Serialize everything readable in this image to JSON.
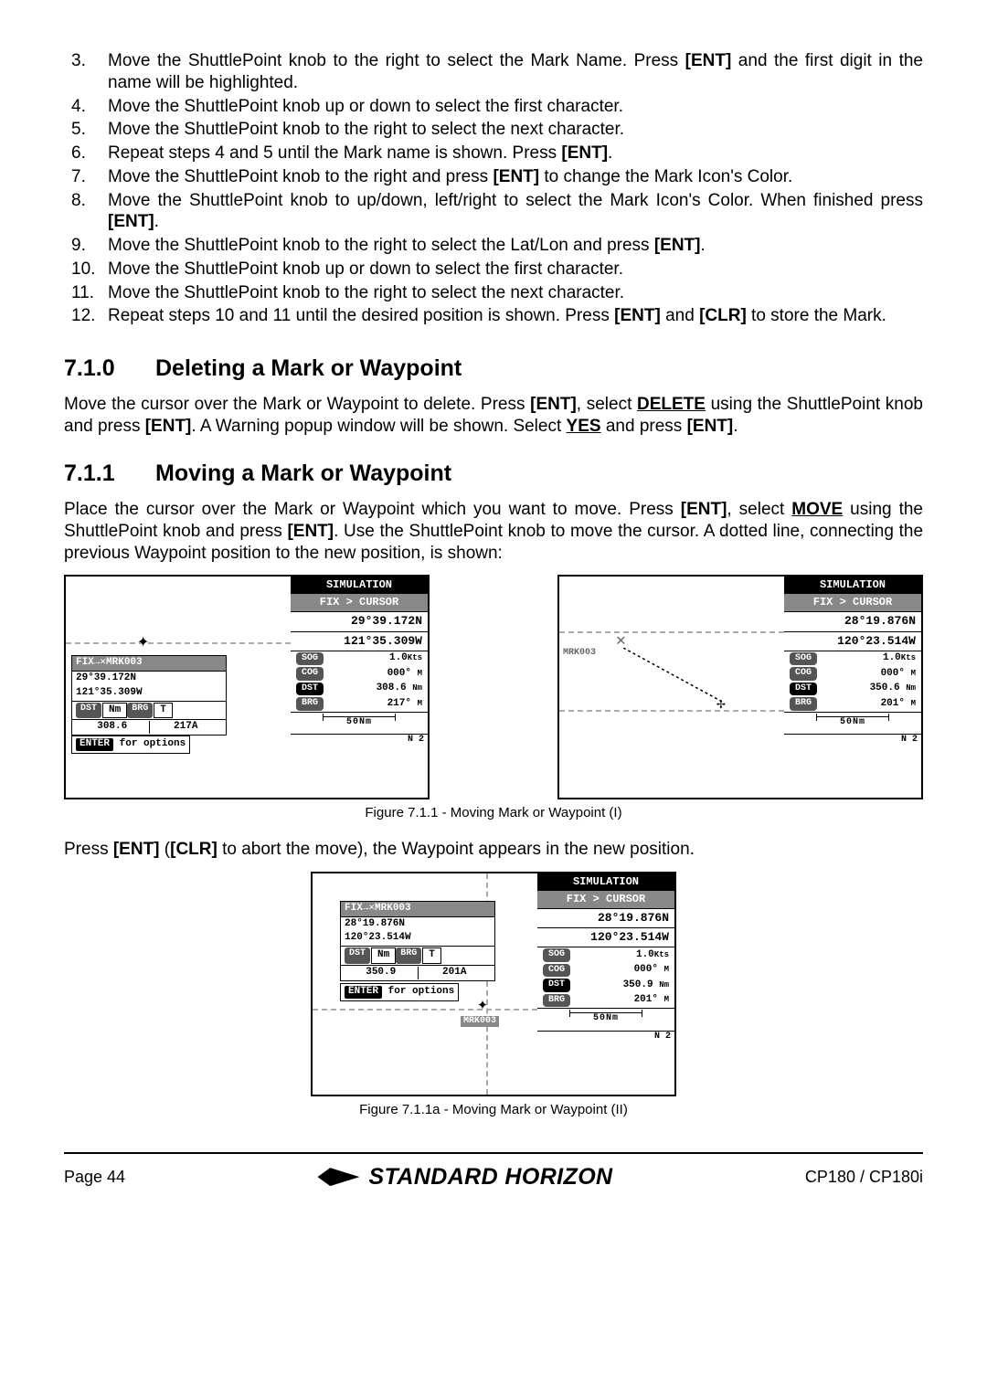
{
  "steps": [
    {
      "num": "3.",
      "text_a": "Move the ShuttlePoint knob to the right to select the Mark Name. Press ",
      "key_a": "[ENT]",
      "text_b": " and the first digit in the name will be highlighted."
    },
    {
      "num": "4.",
      "text_a": "Move the ShuttlePoint knob up or down to select the first character."
    },
    {
      "num": "5.",
      "text_a": "Move the ShuttlePoint knob to the right to select the next character."
    },
    {
      "num": "6.",
      "text_a": "Repeat steps 4 and 5 until the Mark name is shown. Press ",
      "key_a": "[ENT]",
      "text_b": "."
    },
    {
      "num": "7.",
      "text_a": "Move the ShuttlePoint knob to the right and press ",
      "key_a": "[ENT]",
      "text_b": " to change the Mark Icon's Color."
    },
    {
      "num": "8.",
      "text_a": "Move the ShuttlePoint knob to up/down, left/right to select the Mark Icon's Color. When finished press ",
      "key_a": "[ENT]",
      "text_b": "."
    },
    {
      "num": "9.",
      "text_a": "Move the ShuttlePoint knob to the right to select the Lat/Lon and press ",
      "key_a": "[ENT]",
      "text_b": "."
    },
    {
      "num": "10.",
      "text_a": "Move the ShuttlePoint knob up or down to select the first character."
    },
    {
      "num": "11.",
      "text_a": "Move the ShuttlePoint knob to the right to select the next character."
    },
    {
      "num": "12.",
      "text_a": "Repeat steps 10 and 11 until the desired position is shown. Press ",
      "key_a": "[ENT]",
      "text_b": " and ",
      "key_b": "[CLR]",
      "text_c": " to store the Mark."
    }
  ],
  "h710": {
    "num": "7.1.0",
    "title": "Deleting a Mark or Waypoint"
  },
  "p710": {
    "t1": "Move the cursor over the Mark or Waypoint to delete. Press ",
    "k1": "[ENT]",
    "t2": ", select ",
    "u1": "DELETE",
    "t3": " using the ShuttlePoint knob and press ",
    "k2": "[ENT]",
    "t4": ". A Warning popup window will be shown. Select ",
    "u2": "YES",
    "t5": " and press ",
    "k3": "[ENT]",
    "t6": "."
  },
  "h711": {
    "num": "7.1.1",
    "title": "Moving a Mark or Waypoint"
  },
  "p711": {
    "t1": "Place the cursor over the Mark or Waypoint which you want to move. Press ",
    "k1": "[ENT]",
    "t2": ", select ",
    "u1": "MOVE",
    "t3": " using the ShuttlePoint knob and press ",
    "k2": "[ENT]",
    "t4": ". Use the ShuttlePoint knob to move the cursor. A dotted line, connecting the previous Waypoint position to the new position, is shown:"
  },
  "fig1": {
    "caption": "Figure 7.1.1 - Moving Mark or Waypoint (I)",
    "left": {
      "mark_label": "FIX→✕MRK003",
      "lat": "29°39.172N",
      "lon": "121°35.309W",
      "dst_label": "DST",
      "dst_unit": "Nm",
      "brg_label": "BRG",
      "brg_unit": "T",
      "dst": "308.6",
      "brg": "217A",
      "enter_label": "ENTER",
      "enter_text": "for options",
      "sim": "SIMULATION",
      "mode": "FIX > CURSOR",
      "s_lat": "29°39.172N",
      "s_lon": "121°35.309W",
      "sog_l": "SOG",
      "sog": "1.0",
      "sog_u": "Kts",
      "cog_l": "COG",
      "cog": "000°",
      "cog_u": "M",
      "dst2_l": "DST",
      "dst2": "308.6",
      "dst2_u": "Nm",
      "brg2_l": "BRG",
      "brg2": "217°",
      "brg2_u": "M",
      "scale": "50Nm",
      "n": "N 2"
    },
    "right": {
      "mark_label": "MRK003",
      "sim": "SIMULATION",
      "mode": "FIX > CURSOR",
      "s_lat": "28°19.876N",
      "s_lon": "120°23.514W",
      "sog_l": "SOG",
      "sog": "1.0",
      "sog_u": "Kts",
      "cog_l": "COG",
      "cog": "000°",
      "cog_u": "M",
      "dst2_l": "DST",
      "dst2": "350.6",
      "dst2_u": "Nm",
      "brg2_l": "BRG",
      "brg2": "201°",
      "brg2_u": "M",
      "scale": "50Nm",
      "n": "N 2"
    }
  },
  "p_press": {
    "t1": "Press ",
    "k1": "[ENT]",
    "t2": " (",
    "k2": "[CLR]",
    "t3": " to abort the move), the Waypoint appears in the new position."
  },
  "fig2": {
    "caption": "Figure 7.1.1a - Moving Mark or Waypoint (II)",
    "mark_label": "FIX→✕MRK003",
    "lat": "28°19.876N",
    "lon": "120°23.514W",
    "dst_label": "DST",
    "dst_unit": "Nm",
    "brg_label": "BRG",
    "brg_unit": "T",
    "dst": "350.9",
    "brg": "201A",
    "enter_label": "ENTER",
    "enter_text": "for options",
    "mrk_below": "MRK003",
    "sim": "SIMULATION",
    "mode": "FIX > CURSOR",
    "s_lat": "28°19.876N",
    "s_lon": "120°23.514W",
    "sog_l": "SOG",
    "sog": "1.0",
    "sog_u": "Kts",
    "cog_l": "COG",
    "cog": "000°",
    "cog_u": "M",
    "dst2_l": "DST",
    "dst2": "350.9",
    "dst2_u": "Nm",
    "brg2_l": "BRG",
    "brg2": "201°",
    "brg2_u": "M",
    "scale": "50Nm",
    "n": "N 2"
  },
  "footer": {
    "page": "Page  44",
    "brand": "STANDARD HORIZON",
    "model": "CP180 / CP180i"
  }
}
